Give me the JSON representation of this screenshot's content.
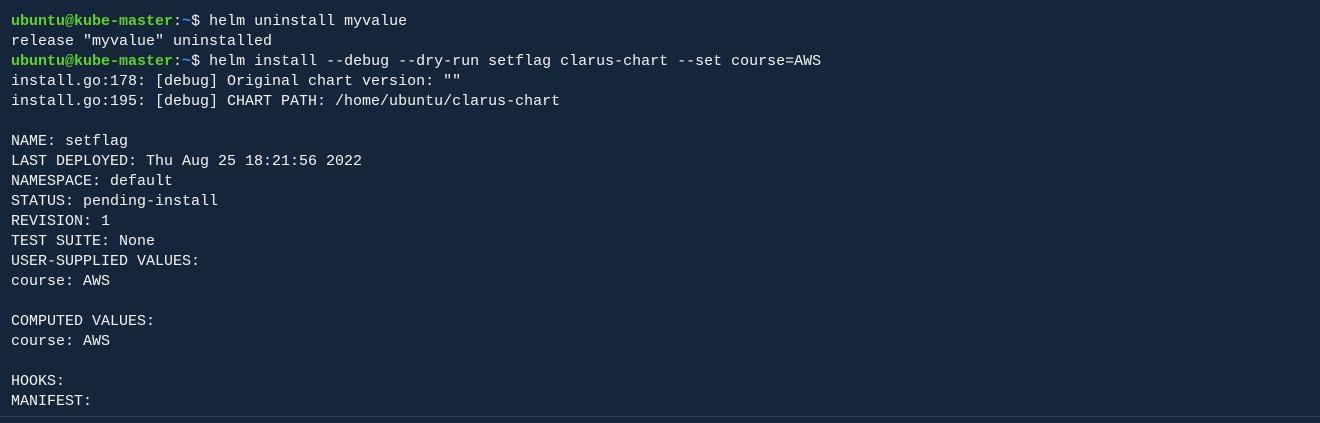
{
  "terminal": {
    "prompt_user": "ubuntu@kube-master",
    "prompt_sep": ":",
    "prompt_path": "~",
    "prompt_symbol": "$ ",
    "lines": [
      {
        "type": "prompt",
        "command": "helm uninstall myvalue"
      },
      {
        "type": "output",
        "text": "release \"myvalue\" uninstalled"
      },
      {
        "type": "prompt",
        "command": "helm install --debug --dry-run setflag clarus-chart --set course=AWS"
      },
      {
        "type": "output",
        "text": "install.go:178: [debug] Original chart version: \"\""
      },
      {
        "type": "output",
        "text": "install.go:195: [debug] CHART PATH: /home/ubuntu/clarus-chart"
      },
      {
        "type": "output",
        "text": ""
      },
      {
        "type": "output",
        "text": "NAME: setflag"
      },
      {
        "type": "output",
        "text": "LAST DEPLOYED: Thu Aug 25 18:21:56 2022"
      },
      {
        "type": "output",
        "text": "NAMESPACE: default"
      },
      {
        "type": "output",
        "text": "STATUS: pending-install"
      },
      {
        "type": "output",
        "text": "REVISION: 1"
      },
      {
        "type": "output",
        "text": "TEST SUITE: None"
      },
      {
        "type": "output",
        "text": "USER-SUPPLIED VALUES:"
      },
      {
        "type": "output",
        "text": "course: AWS"
      },
      {
        "type": "output",
        "text": ""
      },
      {
        "type": "output",
        "text": "COMPUTED VALUES:"
      },
      {
        "type": "output",
        "text": "course: AWS"
      },
      {
        "type": "output",
        "text": ""
      },
      {
        "type": "output",
        "text": "HOOKS:"
      },
      {
        "type": "output",
        "text": "MANIFEST:"
      }
    ]
  },
  "colors": {
    "background": "#15263a",
    "user": "#5fd32a",
    "path": "#3b8eea",
    "text": "#f2f2f2"
  }
}
